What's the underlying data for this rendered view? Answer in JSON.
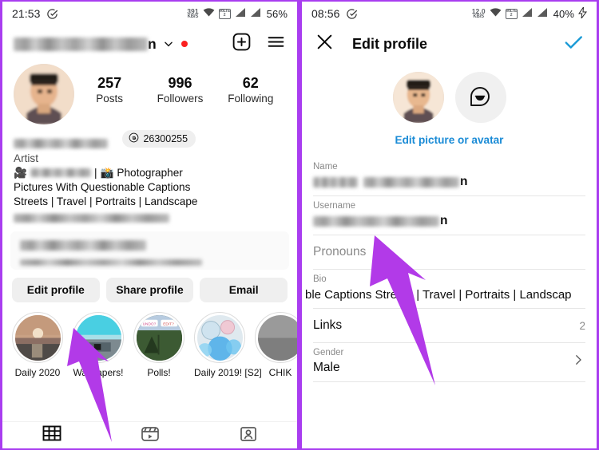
{
  "left_panel": {
    "status_bar": {
      "time": "21:53",
      "net_speed_value": "391",
      "net_speed_unit": "KB/S",
      "volte_label_top": "VoLTE",
      "volte_label_bottom": "2",
      "battery": "56%",
      "icons": [
        "clock-check-icon",
        "wifi-icon",
        "volte-icon",
        "signal-icon",
        "signal-icon"
      ]
    },
    "top_bar": {
      "username_visible_tail": "n",
      "chevron": "chevron-down-icon",
      "has_unread_dot": true,
      "new_post_icon": "plus-box-icon",
      "menu_icon": "hamburger-menu-icon"
    },
    "profile": {
      "stats": [
        {
          "number": "257",
          "label": "Posts"
        },
        {
          "number": "996",
          "label": "Followers"
        },
        {
          "number": "62",
          "label": "Following"
        }
      ],
      "threads_badge": {
        "icon": "threads-icon",
        "count": "26300255"
      },
      "bio": {
        "category": "Artist",
        "line_video_icon": "movie-camera-icon",
        "line_camera_icon": "camera-icon",
        "line_role": "Photographer",
        "line_separator": "|",
        "line2": "Pictures With Questionable Captions",
        "line3": "Streets | Travel | Portraits | Landscape"
      },
      "dashboard": {
        "title_blurred": true,
        "subtitle_blurred": true
      },
      "actions": [
        {
          "label": "Edit profile"
        },
        {
          "label": "Share profile"
        },
        {
          "label": "Email"
        }
      ],
      "highlights": [
        {
          "label": "Daily 2020"
        },
        {
          "label": "Wallpapers!"
        },
        {
          "label": "Polls!"
        },
        {
          "label": "Daily 2019! [S2]"
        },
        {
          "label": "CHIK"
        }
      ],
      "tabs": [
        {
          "icon": "grid-icon",
          "active": true
        },
        {
          "icon": "reels-icon",
          "active": false
        },
        {
          "icon": "tagged-person-icon",
          "active": false
        }
      ]
    }
  },
  "right_panel": {
    "status_bar": {
      "time": "08:56",
      "net_speed_value": "12.0",
      "net_speed_unit": "KB/S",
      "volte_label_top": "VoLTE",
      "volte_label_bottom": "2",
      "battery": "40%",
      "charging_icon": "lightning-bolt-icon",
      "icons": [
        "clock-check-icon",
        "wifi-icon",
        "volte-icon",
        "signal-icon",
        "signal-icon"
      ]
    },
    "top_bar": {
      "close_icon": "close-x-icon",
      "title": "Edit profile",
      "confirm_icon": "check-icon",
      "confirm_color": "#1a9ad6"
    },
    "avatar_section": {
      "profile_picture": "user-avatar",
      "avatar_option": "avatar-face-icon",
      "edit_link": "Edit picture or avatar",
      "edit_link_color": "#1a8bd6"
    },
    "fields": [
      {
        "key": "name",
        "label": "Name",
        "value_tail": "n",
        "blurred": true
      },
      {
        "key": "username",
        "label": "Username",
        "value_tail": "n",
        "blurred": true
      },
      {
        "key": "pronouns",
        "label": "Pronouns",
        "placeholder": "Pronouns"
      },
      {
        "key": "bio",
        "label": "Bio",
        "value": "ble Captions Streets | Travel | Portraits | Landscap"
      },
      {
        "key": "links",
        "label": "Links",
        "count": "2"
      },
      {
        "key": "gender",
        "label": "Gender",
        "value": "Male",
        "chevron": "chevron-right-icon"
      }
    ]
  },
  "annotations": {
    "arrow_color": "#b23ae8",
    "arrows": [
      {
        "name": "arrow-edit-profile-button"
      },
      {
        "name": "arrow-username-field"
      }
    ]
  }
}
